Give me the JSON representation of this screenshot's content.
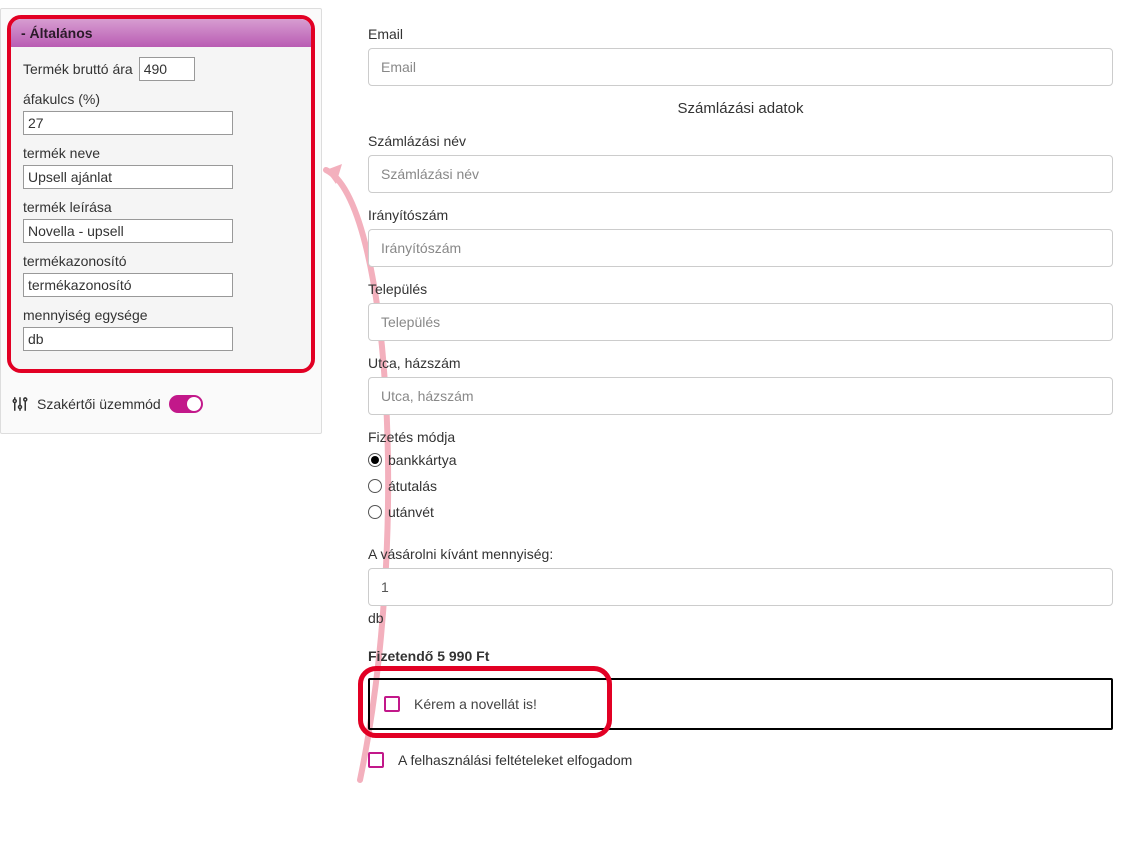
{
  "sidebar": {
    "panel_title": "- Általános",
    "fields": {
      "gross_price": {
        "label": "Termék bruttó ára",
        "value": "490"
      },
      "vat": {
        "label": "áfakulcs (%)",
        "value": "27"
      },
      "product_name": {
        "label": "termék neve",
        "value": "Upsell ajánlat"
      },
      "product_desc": {
        "label": "termék leírása",
        "value": "Novella - upsell"
      },
      "product_id": {
        "label": "termékazonosító",
        "value": "termékazonosító"
      },
      "qty_unit": {
        "label": "mennyiség egysége",
        "value": "db"
      }
    },
    "expert_mode_label": "Szakértői üzemmód",
    "expert_mode_on": true
  },
  "form": {
    "email": {
      "label": "Email",
      "placeholder": "Email"
    },
    "section_billing_title": "Számlázási adatok",
    "billing_name": {
      "label": "Számlázási név",
      "placeholder": "Számlázási név"
    },
    "zip": {
      "label": "Irányítószám",
      "placeholder": "Irányítószám"
    },
    "city": {
      "label": "Település",
      "placeholder": "Település"
    },
    "street": {
      "label": "Utca, házszám",
      "placeholder": "Utca, házszám"
    },
    "payment": {
      "label": "Fizetés módja",
      "options": {
        "card": "bankkártya",
        "transfer": "átutalás",
        "cod": "utánvét"
      },
      "selected": "card"
    },
    "quantity": {
      "label": "A vásárolni kívánt mennyiség:",
      "value": "1",
      "unit": "db"
    },
    "total_label": "Fizetendő 5 990 Ft",
    "upsell_checkbox_label": "Kérem a novellát is!",
    "terms_label": "A felhasználási feltételeket elfogadom"
  }
}
